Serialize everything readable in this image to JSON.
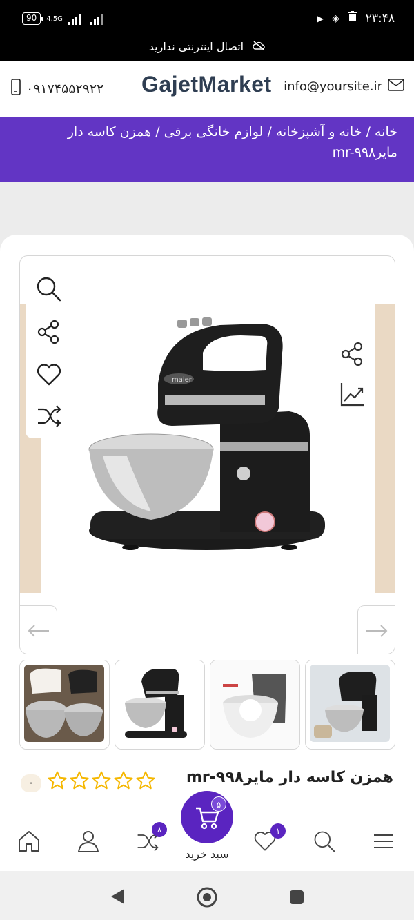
{
  "status_bar": {
    "time": "۲۳:۴۸",
    "battery": "90",
    "network": "4.5G",
    "offline_text": "اتصال اینترنتی ندارید"
  },
  "header": {
    "phone": "۰۹۱۷۴۵۵۲۹۲۲",
    "logo": "GajetMarket",
    "email": "info@yoursite.ir"
  },
  "breadcrumb": {
    "text": "خانه / خانه و آشپزخانه / لوازم خانگی برقی / همزن کاسه دار مایرmr-۹۹۸"
  },
  "product": {
    "title": "همزن کاسه دار مایرmr-۹۹۸",
    "rating_count": "۰",
    "stars_filled": 0,
    "stars_total": 5,
    "brand_on_image": "maier"
  },
  "bottom_nav": {
    "cart_label": "سبد خرید",
    "cart_count": "۵",
    "compare_count": "۸",
    "wishlist_count": "۱"
  },
  "colors": {
    "primary": "#6235c4",
    "star": "#f5b700",
    "badge": "#5a24c0"
  }
}
